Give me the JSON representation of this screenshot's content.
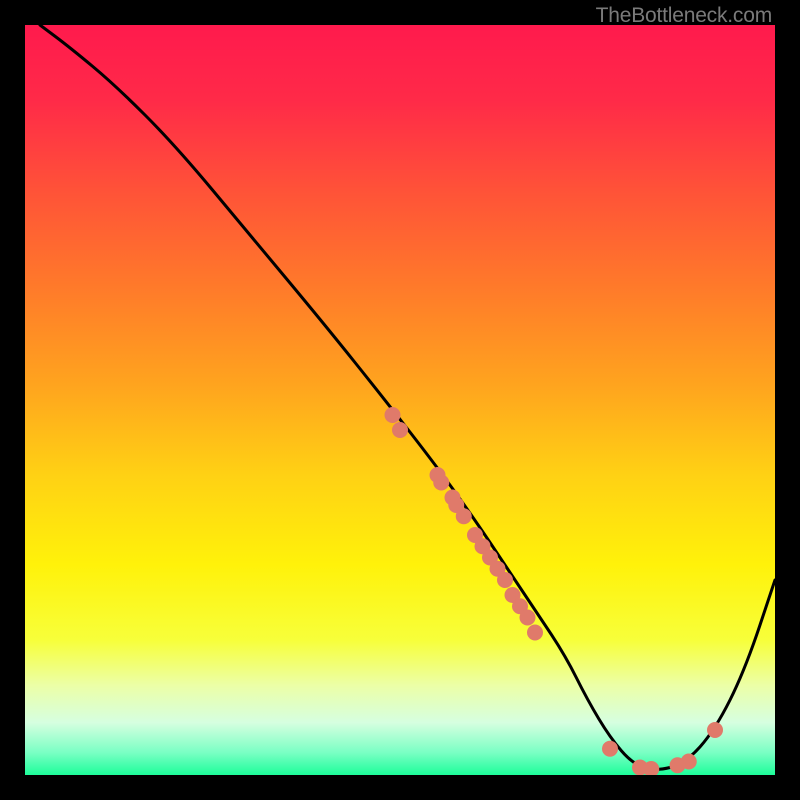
{
  "watermark": "TheBottleneck.com",
  "chart_data": {
    "type": "line",
    "title": "",
    "xlabel": "",
    "ylabel": "",
    "xlim": [
      0,
      100
    ],
    "ylim": [
      0,
      100
    ],
    "grid": false,
    "legend": false,
    "gradient_stops": [
      {
        "offset": 0.0,
        "color": "#ff1a4d"
      },
      {
        "offset": 0.1,
        "color": "#ff2a48"
      },
      {
        "offset": 0.22,
        "color": "#ff5238"
      },
      {
        "offset": 0.35,
        "color": "#ff7a2a"
      },
      {
        "offset": 0.48,
        "color": "#ffa41e"
      },
      {
        "offset": 0.6,
        "color": "#ffd114"
      },
      {
        "offset": 0.72,
        "color": "#fff20a"
      },
      {
        "offset": 0.82,
        "color": "#f7ff3a"
      },
      {
        "offset": 0.88,
        "color": "#ecffa6"
      },
      {
        "offset": 0.93,
        "color": "#d6ffe0"
      },
      {
        "offset": 0.97,
        "color": "#7affc4"
      },
      {
        "offset": 1.0,
        "color": "#1dfd9a"
      }
    ],
    "series": [
      {
        "name": "curve",
        "x": [
          2,
          6,
          12,
          20,
          30,
          40,
          48,
          55,
          60,
          64,
          68,
          72,
          75,
          78,
          81,
          84,
          88,
          92,
          96,
          100
        ],
        "y": [
          100,
          97,
          92,
          84,
          72,
          60,
          50,
          41,
          34,
          28,
          22,
          16,
          10,
          5,
          1.5,
          0.5,
          1.5,
          6,
          14,
          26
        ]
      }
    ],
    "points": {
      "name": "dots",
      "color": "#e07a6a",
      "radius": 8,
      "coords": [
        {
          "x": 49,
          "y": 48
        },
        {
          "x": 50,
          "y": 46
        },
        {
          "x": 55,
          "y": 40
        },
        {
          "x": 55.5,
          "y": 39
        },
        {
          "x": 57,
          "y": 37
        },
        {
          "x": 57.5,
          "y": 36
        },
        {
          "x": 58.5,
          "y": 34.5
        },
        {
          "x": 60,
          "y": 32
        },
        {
          "x": 61,
          "y": 30.5
        },
        {
          "x": 62,
          "y": 29
        },
        {
          "x": 63,
          "y": 27.5
        },
        {
          "x": 64,
          "y": 26
        },
        {
          "x": 65,
          "y": 24
        },
        {
          "x": 66,
          "y": 22.5
        },
        {
          "x": 67,
          "y": 21
        },
        {
          "x": 68,
          "y": 19
        },
        {
          "x": 78,
          "y": 3.5
        },
        {
          "x": 82,
          "y": 1
        },
        {
          "x": 83.5,
          "y": 0.8
        },
        {
          "x": 87,
          "y": 1.3
        },
        {
          "x": 88.5,
          "y": 1.8
        },
        {
          "x": 92,
          "y": 6
        }
      ]
    }
  }
}
